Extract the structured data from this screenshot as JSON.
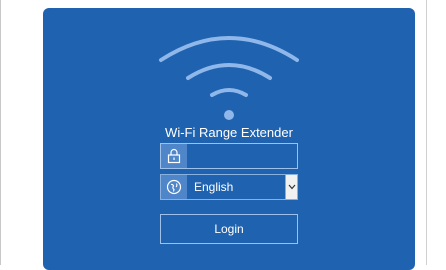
{
  "login": {
    "title": "Wi-Fi Range Extender",
    "password": {
      "value": "",
      "icon": "lock-icon"
    },
    "language": {
      "selected": "English",
      "icon": "globe-icon"
    },
    "login_button_label": "Login"
  },
  "colors": {
    "panel_background": "#1f62b0",
    "icon_background": "#4f86c9",
    "field_border": "#9fc0e8",
    "text": "#ffffff"
  }
}
